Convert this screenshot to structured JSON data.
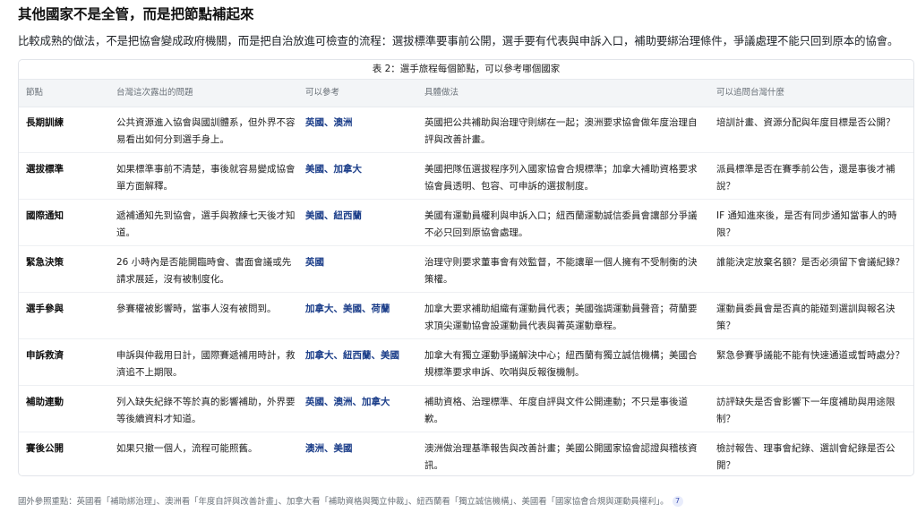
{
  "heading": "其他國家不是全管，而是把節點補起來",
  "lead": "比較成熟的做法，不是把協會變成政府機關，而是把自治放進可檢查的流程：選拔標準要事前公開，選手要有代表與申訴入口，補助要綁治理條件，爭議處理不能只回到原本的協會。",
  "table": {
    "caption": "表 2：選手旅程每個節點，可以參考哪個國家",
    "headers": [
      "節點",
      "台灣這次露出的問題",
      "可以參考",
      "具體做法",
      "可以追問台灣什麼"
    ],
    "rows": [
      {
        "node": "長期訓練",
        "problem": "公共資源進入協會與國訓體系，但外界不容易看出如何分到選手身上。",
        "reference": "英國、澳洲",
        "practice": "英國把公共補助與治理守則綁在一起；澳洲要求協會做年度治理自評與改善計畫。",
        "ask": "培訓計畫、資源分配與年度目標是否公開？"
      },
      {
        "node": "選拔標準",
        "problem": "如果標準事前不清楚，事後就容易變成協會單方面解釋。",
        "reference": "美國、加拿大",
        "practice": "美國把隊伍選拔程序列入國家協會合規標準；加拿大補助資格要求協會員透明、包容、可申訴的選拔制度。",
        "ask": "派員標準是否在賽季前公告，還是事後才補說？"
      },
      {
        "node": "國際通知",
        "problem": "遞補通知先到協會，選手與教練七天後才知道。",
        "reference": "美國、紐西蘭",
        "practice": "美國有運動員權利與申訴入口；紐西蘭運動誠信委員會讓部分爭議不必只回到原協會處理。",
        "ask": "IF 通知進來後，是否有同步通知當事人的時限？"
      },
      {
        "node": "緊急決策",
        "problem": "26 小時內是否能開臨時會、書面會議或先請求展延，沒有被制度化。",
        "reference": "英國",
        "practice": "治理守則要求董事會有效監督，不能讓單一個人擁有不受制衡的決策權。",
        "ask": "誰能決定放棄名額？是否必須留下會議紀錄？"
      },
      {
        "node": "選手參與",
        "problem": "參賽權被影響時，當事人沒有被問到。",
        "reference": "加拿大、美國、荷蘭",
        "practice": "加拿大要求補助組織有運動員代表；美國強調運動員聲音；荷蘭要求頂尖運動協會設運動員代表與菁英運動章程。",
        "ask": "運動員委員會是否真的能碰到選訓與報名決策？"
      },
      {
        "node": "申訴救濟",
        "problem": "申訴與仲裁用日計，國際賽遞補用時計，救濟追不上期限。",
        "reference": "加拿大、紐西蘭、美國",
        "practice": "加拿大有獨立運動爭議解決中心；紐西蘭有獨立誠信機構；美國合規標準要求申訴、吹哨與反報復機制。",
        "ask": "緊急參賽爭議能不能有快速通道或暫時處分？"
      },
      {
        "node": "補助連動",
        "problem": "列入缺失紀錄不等於真的影響補助，外界要等後續資料才知道。",
        "reference": "英國、澳洲、加拿大",
        "practice": "補助資格、治理標準、年度自評與文件公開連動；不只是事後道歉。",
        "ask": "訪評缺失是否會影響下一年度補助與用途限制？"
      },
      {
        "node": "賽後公開",
        "problem": "如果只撤一個人，流程可能照舊。",
        "reference": "澳洲、美國",
        "practice": "澳洲做治理基準報告與改善計畫；美國公開國家協會認證與稽核資訊。",
        "ask": "檢討報告、理事會紀錄、選訓會紀錄是否公開？"
      }
    ]
  },
  "footer": {
    "text": "國外參照重點：英國看「補助綁治理」、澳洲看「年度自評與改善計畫」、加拿大看「補助資格與獨立仲裁」、紐西蘭看「獨立誠信機構」、美國看「國家協會合規與運動員權利」。",
    "citation": "7"
  }
}
